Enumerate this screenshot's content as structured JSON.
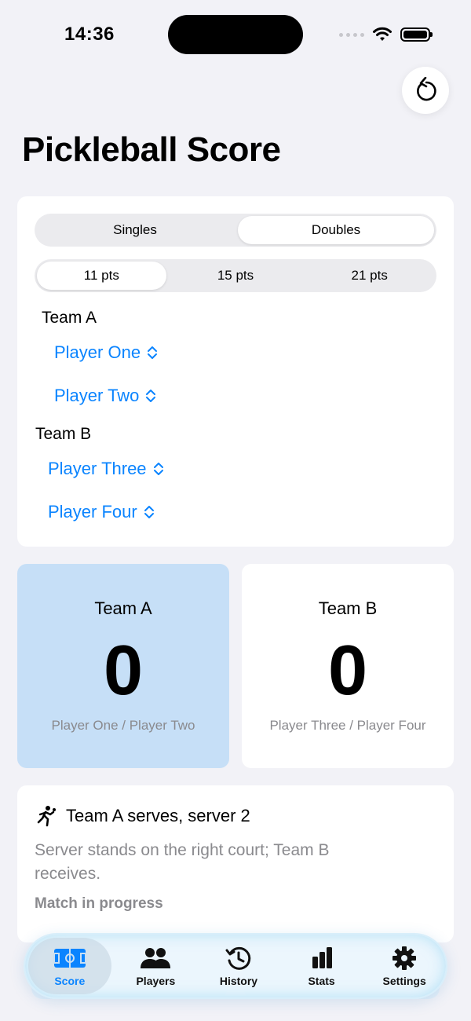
{
  "status": {
    "time": "14:36"
  },
  "page": {
    "title": "Pickleball Score"
  },
  "setup": {
    "mode_options": [
      "Singles",
      "Doubles"
    ],
    "mode_selected": "Doubles",
    "points_options": [
      "11 pts",
      "15 pts",
      "21 pts"
    ],
    "points_selected": "11 pts",
    "team_a": {
      "label": "Team A",
      "player1": "Player One",
      "player2": "Player Two"
    },
    "team_b": {
      "label": "Team B",
      "player1": "Player Three",
      "player2": "Player Four"
    }
  },
  "scoreboard": {
    "team_a": {
      "name": "Team A",
      "score": "0",
      "players": "Player One / Player Two"
    },
    "team_b": {
      "name": "Team B",
      "score": "0",
      "players": "Player Three / Player Four"
    }
  },
  "serve": {
    "title": "Team A serves, server 2",
    "description": "Server stands on the right court; Team B receives.",
    "status": "Match in progress"
  },
  "tabs": [
    {
      "label": "Score",
      "icon": "court-icon",
      "active": true
    },
    {
      "label": "Players",
      "icon": "people-icon",
      "active": false
    },
    {
      "label": "History",
      "icon": "history-icon",
      "active": false
    },
    {
      "label": "Stats",
      "icon": "chart-bars-icon",
      "active": false
    },
    {
      "label": "Settings",
      "icon": "gear-icon",
      "active": false
    }
  ],
  "colors": {
    "accent": "#0a84ff",
    "team_a_highlight": "#c6dff7",
    "background": "#f2f2f7"
  }
}
